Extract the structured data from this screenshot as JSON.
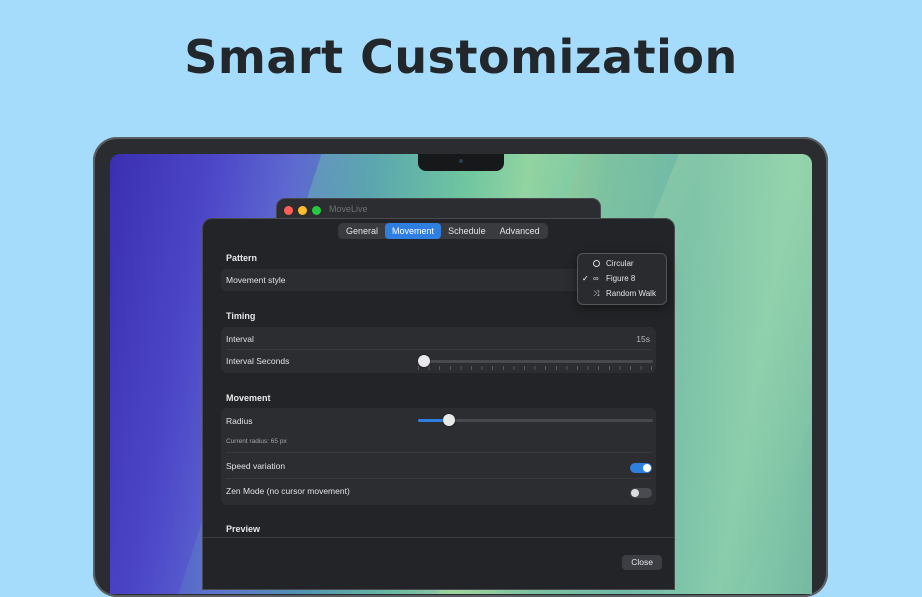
{
  "headline": "Smart Customization",
  "app": {
    "title": "MoveLive"
  },
  "tabs": [
    {
      "label": "General",
      "active": false
    },
    {
      "label": "Movement",
      "active": true
    },
    {
      "label": "Schedule",
      "active": false
    },
    {
      "label": "Advanced",
      "active": false
    }
  ],
  "pattern": {
    "section": "Pattern",
    "movement_style_label": "Movement style",
    "dropdown": {
      "options": [
        {
          "label": "Circular",
          "icon": "circle-icon"
        },
        {
          "label": "Figure 8",
          "icon": "infinity-icon",
          "selected": true
        },
        {
          "label": "Random Walk",
          "icon": "random-walk-icon"
        }
      ],
      "check": "✓"
    }
  },
  "timing": {
    "section": "Timing",
    "interval_label": "Interval",
    "interval_value": "15s",
    "interval_seconds_label": "Interval Seconds",
    "interval_slider_fraction": 0.0
  },
  "movement": {
    "section": "Movement",
    "radius_label": "Radius",
    "radius_slider_fraction": 0.13,
    "current_radius_text": "Current radius: 65 px",
    "speed_variation_label": "Speed variation",
    "speed_variation_on": true,
    "zen_mode_label": "Zen Mode (no cursor movement)",
    "zen_mode_on": false
  },
  "preview": {
    "section": "Preview"
  },
  "footer": {
    "close_label": "Close"
  },
  "colors": {
    "accent": "#2f7fe0",
    "background": "#a6dcfb"
  }
}
